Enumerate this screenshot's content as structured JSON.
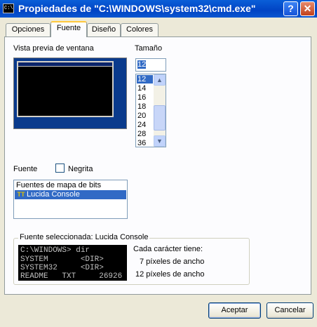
{
  "window": {
    "title": "Propiedades de \"C:\\WINDOWS\\system32\\cmd.exe\"",
    "icon_text": "C:\\",
    "help_button": "?",
    "close_button": "✕"
  },
  "tabs": [
    {
      "label": "Opciones",
      "active": false
    },
    {
      "label": "Fuente",
      "active": true
    },
    {
      "label": "Diseño",
      "active": false
    },
    {
      "label": "Colores",
      "active": false
    }
  ],
  "preview": {
    "label": "Vista previa de ventana"
  },
  "size": {
    "label": "Tamaño",
    "value": "12",
    "options": [
      "12",
      "14",
      "16",
      "18",
      "20",
      "24",
      "28",
      "36"
    ],
    "selected": "12"
  },
  "font": {
    "label": "Fuente",
    "bold_label": "Negrita",
    "bold_checked": false,
    "items": [
      "Fuentes de mapa de bits",
      "Lucida Console"
    ],
    "selected": "Lucida Console",
    "truetype_icon": "TT"
  },
  "selected_font": {
    "title": "Fuente seleccionada: Lucida Console",
    "console_lines": [
      "C:\\WINDOWS> dir",
      "SYSTEM       <DIR>",
      "SYSTEM32     <DIR>",
      "README   TXT     26926"
    ],
    "each_char": "Cada carácter tiene:",
    "width_line": "7 píxeles de ancho",
    "height_line": "12 píxeles de ancho"
  },
  "buttons": {
    "ok": "Aceptar",
    "cancel": "Cancelar"
  }
}
